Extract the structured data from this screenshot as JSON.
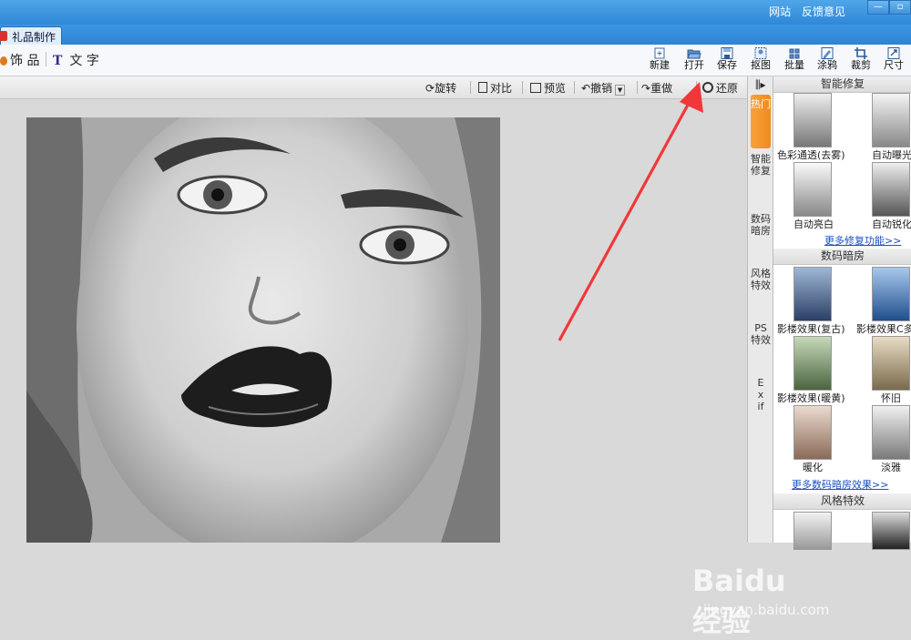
{
  "window": {
    "links": [
      "网站",
      "反馈意见"
    ],
    "min_label": "—",
    "max_label": "▫"
  },
  "tabs": [
    {
      "label": "礼品制作"
    }
  ],
  "toolbar": {
    "left_items": [
      {
        "label": "饰 品",
        "icon": "decoration-icon"
      },
      {
        "label": "文 字",
        "icon": "text-T-icon"
      }
    ],
    "buttons": [
      {
        "label": "新建",
        "icon": "new-icon"
      },
      {
        "label": "打开",
        "icon": "folder-open-icon"
      },
      {
        "label": "保存",
        "icon": "save-icon"
      },
      {
        "label": "抠图",
        "icon": "cutout-icon"
      },
      {
        "label": "批量",
        "icon": "batch-icon"
      },
      {
        "label": "涂鸦",
        "icon": "doodle-icon"
      },
      {
        "label": "裁剪",
        "icon": "crop-icon"
      },
      {
        "label": "尺寸",
        "icon": "resize-icon"
      }
    ]
  },
  "subbar": {
    "rotate": "旋转",
    "compare": "对比",
    "preview": "预览",
    "undo": "撤销",
    "redo": "重做",
    "restore": "还原"
  },
  "side_tabs": [
    "热门",
    "智能修复",
    "数码暗房",
    "风格特效",
    "PS特效",
    "Exif"
  ],
  "panel": {
    "smart_repair": {
      "title": "智能修复",
      "items": [
        "色彩通透(去雾)",
        "自动曝光",
        "自动亮白",
        "自动锐化"
      ],
      "more": "更多修复功能>>"
    },
    "darkroom": {
      "title": "数码暗房",
      "items": [
        "影楼效果(复古)",
        "影楼效果C多",
        "影楼效果(暖黄)",
        "怀旧",
        "暖化",
        "淡雅"
      ],
      "more": "更多数码暗房效果>>"
    },
    "style": {
      "title": "风格特效"
    }
  },
  "watermark": {
    "brand": "Baidu经验",
    "url": "jingyan.baidu.com"
  },
  "colors": {
    "titlebar": "#2f88d8",
    "accent_orange": "#f08a1c",
    "arrow_red": "#f0383a",
    "link": "#1b4fc0"
  }
}
